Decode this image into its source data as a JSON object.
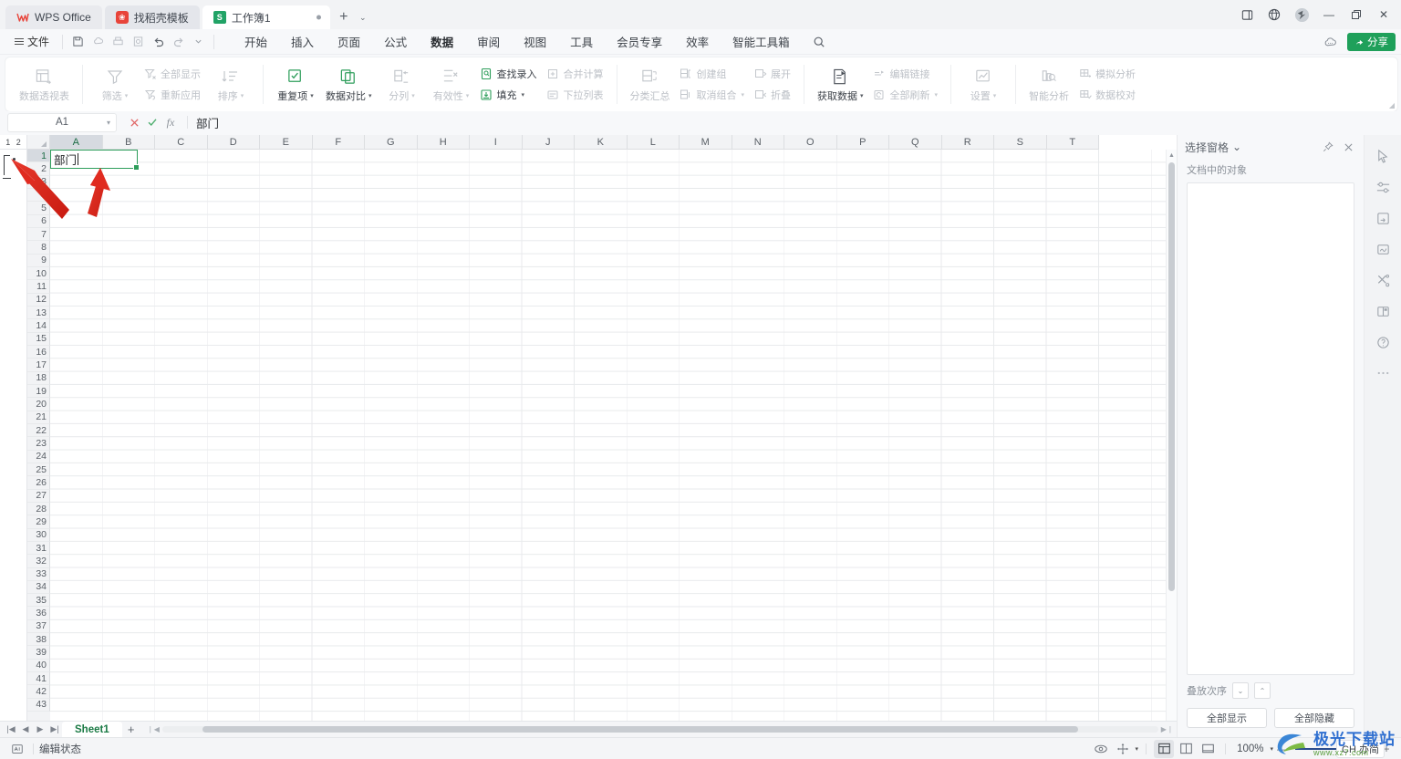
{
  "window": {
    "tabs": [
      {
        "label": "WPS Office",
        "icon": "wps-logo-icon",
        "type": "home"
      },
      {
        "label": "找稻壳模板",
        "icon": "docer-icon",
        "type": "docer"
      },
      {
        "label": "工作簿1",
        "icon": "sheet-icon",
        "type": "doc",
        "active": true
      }
    ],
    "new_tab": "+",
    "tab_chevron": "⌄",
    "controls": {
      "minimize": "—",
      "restore": "❐",
      "close": "✕"
    },
    "right_icons": [
      "panel-icon",
      "globe-icon",
      "avatar-icon"
    ]
  },
  "menubar": {
    "file_label": "文件",
    "quick_access": [
      "save-icon",
      "cloud-sync-icon",
      "print-icon",
      "print-preview-icon",
      "undo-icon",
      "redo-icon",
      "customize-chevron-icon"
    ],
    "items": [
      {
        "label": "开始"
      },
      {
        "label": "插入"
      },
      {
        "label": "页面"
      },
      {
        "label": "公式"
      },
      {
        "label": "数据",
        "active": true
      },
      {
        "label": "审阅"
      },
      {
        "label": "视图"
      },
      {
        "label": "工具"
      },
      {
        "label": "会员专享"
      },
      {
        "label": "效率"
      },
      {
        "label": "智能工具箱"
      }
    ],
    "search_icon": "search-icon",
    "cloud_icon": "cloud-icon",
    "share_label": "分享"
  },
  "ribbon": {
    "groups": [
      {
        "name": "pivot",
        "buttons": [
          {
            "label": "数据透视表",
            "style": "big",
            "icon": "pivot-table-icon",
            "enabled": false
          }
        ]
      },
      {
        "name": "sort-filter",
        "buttons": [
          {
            "label": "筛选",
            "style": "big",
            "icon": "filter-icon",
            "enabled": false,
            "caret": true
          },
          {
            "label": "全部显示",
            "style": "small",
            "icon": "show-all-icon",
            "enabled": false
          },
          {
            "label": "重新应用",
            "style": "small",
            "icon": "reapply-icon",
            "enabled": false
          },
          {
            "label": "排序",
            "style": "big",
            "icon": "sort-icon",
            "enabled": false,
            "caret": true
          }
        ]
      },
      {
        "name": "data-tools",
        "buttons": [
          {
            "label": "重复项",
            "style": "big",
            "icon": "duplicate-icon",
            "enabled": true,
            "caret": true
          },
          {
            "label": "数据对比",
            "style": "big",
            "icon": "data-compare-icon",
            "enabled": true,
            "caret": true
          },
          {
            "label": "分列",
            "style": "big",
            "icon": "split-column-icon",
            "enabled": false,
            "caret": true
          },
          {
            "label": "有效性",
            "style": "big",
            "icon": "validation-icon",
            "enabled": false,
            "caret": true
          },
          {
            "label": "查找录入",
            "style": "small",
            "icon": "lookup-entry-icon",
            "enabled": true
          },
          {
            "label": "填充",
            "style": "small",
            "icon": "fill-icon",
            "enabled": true,
            "caret": true
          },
          {
            "label": "合并计算",
            "style": "small",
            "icon": "consolidate-icon",
            "enabled": false
          },
          {
            "label": "下拉列表",
            "style": "small",
            "icon": "dropdown-list-icon",
            "enabled": false
          }
        ]
      },
      {
        "name": "outline",
        "buttons": [
          {
            "label": "分类汇总",
            "style": "big",
            "icon": "subtotal-icon",
            "enabled": false
          },
          {
            "label": "创建组",
            "style": "small",
            "icon": "create-group-icon",
            "enabled": false
          },
          {
            "label": "取消组合",
            "style": "small",
            "icon": "ungroup-icon",
            "enabled": false,
            "caret": true
          },
          {
            "label": "展开",
            "style": "small",
            "icon": "expand-icon",
            "enabled": false
          },
          {
            "label": "折叠",
            "style": "small",
            "icon": "collapse-icon",
            "enabled": false
          }
        ]
      },
      {
        "name": "get-data",
        "buttons": [
          {
            "label": "获取数据",
            "style": "big",
            "icon": "get-data-icon",
            "enabled": true,
            "caret": true
          },
          {
            "label": "编辑链接",
            "style": "small",
            "icon": "edit-links-icon",
            "enabled": false
          },
          {
            "label": "全部刷新",
            "style": "small",
            "icon": "refresh-all-icon",
            "enabled": false,
            "caret": true
          }
        ]
      },
      {
        "name": "config",
        "buttons": [
          {
            "label": "设置",
            "style": "big",
            "icon": "settings-chart-icon",
            "enabled": false,
            "caret": true
          }
        ]
      },
      {
        "name": "analysis",
        "buttons": [
          {
            "label": "智能分析",
            "style": "big",
            "icon": "smart-analysis-icon",
            "enabled": false
          },
          {
            "label": "模拟分析",
            "style": "small",
            "icon": "what-if-icon",
            "enabled": false
          },
          {
            "label": "数据校对",
            "style": "small",
            "icon": "data-proofread-icon",
            "enabled": false
          }
        ]
      }
    ]
  },
  "formula_bar": {
    "name_box_value": "A1",
    "cancel_icon": "cancel-icon",
    "confirm_icon": "confirm-icon",
    "fx_icon": "fx-icon",
    "formula_value": "部门"
  },
  "outline_pane": {
    "levels": [
      "1",
      "2"
    ]
  },
  "grid": {
    "columns": [
      "A",
      "B",
      "C",
      "D",
      "E",
      "F",
      "G",
      "H",
      "I",
      "J",
      "K",
      "L",
      "M",
      "N",
      "O",
      "P",
      "Q",
      "R",
      "S",
      "T"
    ],
    "selected_column": "A",
    "rows": [
      1,
      2,
      3,
      4,
      5,
      6,
      7,
      8,
      9,
      10,
      11,
      12,
      13,
      14,
      15,
      16,
      17,
      18,
      19,
      20,
      21,
      22,
      23,
      24,
      25,
      26,
      27,
      28,
      29,
      30,
      31,
      32,
      33,
      34,
      35,
      36,
      37,
      38,
      39,
      40,
      41,
      42,
      43
    ],
    "selected_row": 1,
    "editing_cell": {
      "ref": "A1",
      "value": "部门"
    }
  },
  "sheet_bar": {
    "nav": [
      "first-sheet-icon",
      "prev-sheet-icon",
      "next-sheet-icon",
      "last-sheet-icon"
    ],
    "sheets": [
      {
        "name": "Sheet1",
        "active": true
      }
    ],
    "add_label": "+"
  },
  "right_panel": {
    "title": "选择窗格",
    "title_caret": "⌄",
    "pin_icon": "pin-icon",
    "close_icon": "close-icon",
    "subtitle": "文档中的对象",
    "objects": [],
    "order_label": "叠放次序",
    "order_down": "⌄",
    "order_up": "⌃",
    "show_all_label": "全部显示",
    "hide_all_label": "全部隐藏"
  },
  "rail": {
    "icons": [
      "cursor-select-icon",
      "settings-slider-icon",
      "cell-format-icon",
      "signature-icon",
      "tools-icon",
      "book-icon",
      "help-icon",
      "more-icon"
    ]
  },
  "status_bar": {
    "mode_icon": "edit-mode-icon",
    "mode_text": "编辑状态",
    "eye_icon": "eye-icon",
    "move-icon": "move-icon",
    "views": [
      {
        "name": "normal-view",
        "active": true
      },
      {
        "name": "page-layout-view",
        "active": false
      },
      {
        "name": "page-break-view",
        "active": false
      }
    ],
    "zoom_label": "100%",
    "zoom_out": "—",
    "zoom_in": "+"
  },
  "watermark": {
    "main": "极光下载站",
    "sub": "www.xz7.com",
    "badge": "CH 办简"
  },
  "colors": {
    "accent_green": "#1fa05a",
    "active_tab_underline": "#28a05f",
    "cell_border": "#2e9e5b",
    "arrow_red": "#e02b20",
    "panel_bg": "#f7f8fa"
  }
}
